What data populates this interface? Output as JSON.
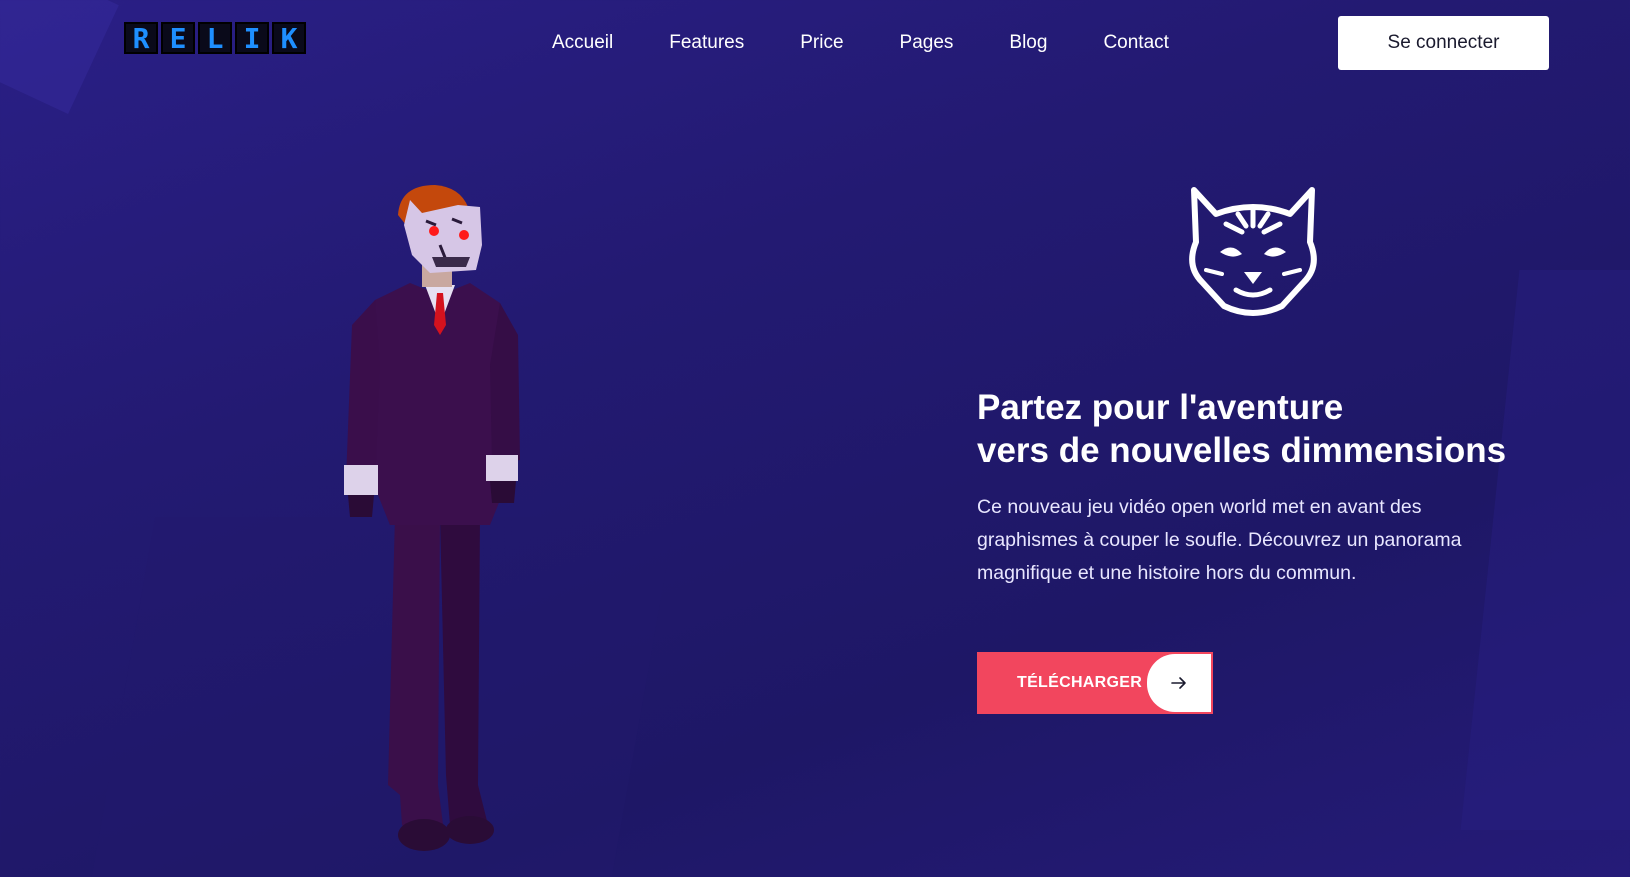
{
  "brand": {
    "logo_letters": [
      "R",
      "E",
      "L",
      "I",
      "K"
    ],
    "logo_color": "#1e8fff"
  },
  "nav": {
    "items": [
      {
        "label": "Accueil"
      },
      {
        "label": "Features"
      },
      {
        "label": "Price"
      },
      {
        "label": "Pages"
      },
      {
        "label": "Blog"
      },
      {
        "label": "Contact"
      }
    ],
    "login_label": "Se connecter"
  },
  "hero": {
    "title_line1": "Partez pour l'aventure",
    "title_line2": "vers de nouvelles dimmensions",
    "description": "Ce nouveau jeu vidéo open world met en avant des graphismes à couper le soufle. Découvrez un panorama magnifique et une histoire hors du commun.",
    "cta_label": "TÉLÉCHARGER",
    "cta_color": "#f2465e",
    "cta_icon": "arrow-right-icon",
    "emblem_icon": "cat-head-icon"
  },
  "colors": {
    "background": "#231a72",
    "accent": "#f2465e",
    "text": "#ffffff"
  }
}
